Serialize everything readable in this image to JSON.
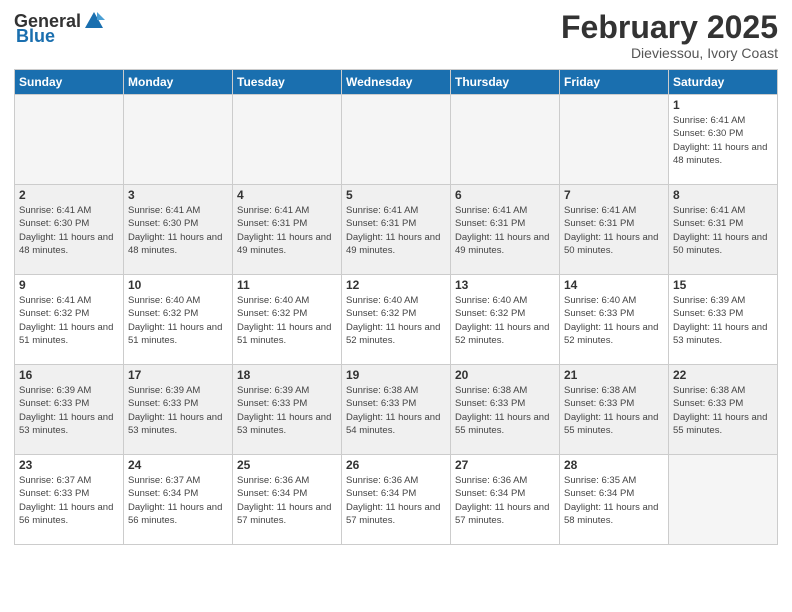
{
  "header": {
    "logo_general": "General",
    "logo_blue": "Blue",
    "title": "February 2025",
    "subtitle": "Dieviessou, Ivory Coast"
  },
  "days_of_week": [
    "Sunday",
    "Monday",
    "Tuesday",
    "Wednesday",
    "Thursday",
    "Friday",
    "Saturday"
  ],
  "weeks": [
    {
      "shade": false,
      "days": [
        {
          "num": "",
          "info": ""
        },
        {
          "num": "",
          "info": ""
        },
        {
          "num": "",
          "info": ""
        },
        {
          "num": "",
          "info": ""
        },
        {
          "num": "",
          "info": ""
        },
        {
          "num": "",
          "info": ""
        },
        {
          "num": "1",
          "info": "Sunrise: 6:41 AM\nSunset: 6:30 PM\nDaylight: 11 hours and 48 minutes."
        }
      ]
    },
    {
      "shade": true,
      "days": [
        {
          "num": "2",
          "info": "Sunrise: 6:41 AM\nSunset: 6:30 PM\nDaylight: 11 hours and 48 minutes."
        },
        {
          "num": "3",
          "info": "Sunrise: 6:41 AM\nSunset: 6:30 PM\nDaylight: 11 hours and 48 minutes."
        },
        {
          "num": "4",
          "info": "Sunrise: 6:41 AM\nSunset: 6:31 PM\nDaylight: 11 hours and 49 minutes."
        },
        {
          "num": "5",
          "info": "Sunrise: 6:41 AM\nSunset: 6:31 PM\nDaylight: 11 hours and 49 minutes."
        },
        {
          "num": "6",
          "info": "Sunrise: 6:41 AM\nSunset: 6:31 PM\nDaylight: 11 hours and 49 minutes."
        },
        {
          "num": "7",
          "info": "Sunrise: 6:41 AM\nSunset: 6:31 PM\nDaylight: 11 hours and 50 minutes."
        },
        {
          "num": "8",
          "info": "Sunrise: 6:41 AM\nSunset: 6:31 PM\nDaylight: 11 hours and 50 minutes."
        }
      ]
    },
    {
      "shade": false,
      "days": [
        {
          "num": "9",
          "info": "Sunrise: 6:41 AM\nSunset: 6:32 PM\nDaylight: 11 hours and 51 minutes."
        },
        {
          "num": "10",
          "info": "Sunrise: 6:40 AM\nSunset: 6:32 PM\nDaylight: 11 hours and 51 minutes."
        },
        {
          "num": "11",
          "info": "Sunrise: 6:40 AM\nSunset: 6:32 PM\nDaylight: 11 hours and 51 minutes."
        },
        {
          "num": "12",
          "info": "Sunrise: 6:40 AM\nSunset: 6:32 PM\nDaylight: 11 hours and 52 minutes."
        },
        {
          "num": "13",
          "info": "Sunrise: 6:40 AM\nSunset: 6:32 PM\nDaylight: 11 hours and 52 minutes."
        },
        {
          "num": "14",
          "info": "Sunrise: 6:40 AM\nSunset: 6:33 PM\nDaylight: 11 hours and 52 minutes."
        },
        {
          "num": "15",
          "info": "Sunrise: 6:39 AM\nSunset: 6:33 PM\nDaylight: 11 hours and 53 minutes."
        }
      ]
    },
    {
      "shade": true,
      "days": [
        {
          "num": "16",
          "info": "Sunrise: 6:39 AM\nSunset: 6:33 PM\nDaylight: 11 hours and 53 minutes."
        },
        {
          "num": "17",
          "info": "Sunrise: 6:39 AM\nSunset: 6:33 PM\nDaylight: 11 hours and 53 minutes."
        },
        {
          "num": "18",
          "info": "Sunrise: 6:39 AM\nSunset: 6:33 PM\nDaylight: 11 hours and 53 minutes."
        },
        {
          "num": "19",
          "info": "Sunrise: 6:38 AM\nSunset: 6:33 PM\nDaylight: 11 hours and 54 minutes."
        },
        {
          "num": "20",
          "info": "Sunrise: 6:38 AM\nSunset: 6:33 PM\nDaylight: 11 hours and 55 minutes."
        },
        {
          "num": "21",
          "info": "Sunrise: 6:38 AM\nSunset: 6:33 PM\nDaylight: 11 hours and 55 minutes."
        },
        {
          "num": "22",
          "info": "Sunrise: 6:38 AM\nSunset: 6:33 PM\nDaylight: 11 hours and 55 minutes."
        }
      ]
    },
    {
      "shade": false,
      "days": [
        {
          "num": "23",
          "info": "Sunrise: 6:37 AM\nSunset: 6:33 PM\nDaylight: 11 hours and 56 minutes."
        },
        {
          "num": "24",
          "info": "Sunrise: 6:37 AM\nSunset: 6:34 PM\nDaylight: 11 hours and 56 minutes."
        },
        {
          "num": "25",
          "info": "Sunrise: 6:36 AM\nSunset: 6:34 PM\nDaylight: 11 hours and 57 minutes."
        },
        {
          "num": "26",
          "info": "Sunrise: 6:36 AM\nSunset: 6:34 PM\nDaylight: 11 hours and 57 minutes."
        },
        {
          "num": "27",
          "info": "Sunrise: 6:36 AM\nSunset: 6:34 PM\nDaylight: 11 hours and 57 minutes."
        },
        {
          "num": "28",
          "info": "Sunrise: 6:35 AM\nSunset: 6:34 PM\nDaylight: 11 hours and 58 minutes."
        },
        {
          "num": "",
          "info": ""
        }
      ]
    }
  ]
}
